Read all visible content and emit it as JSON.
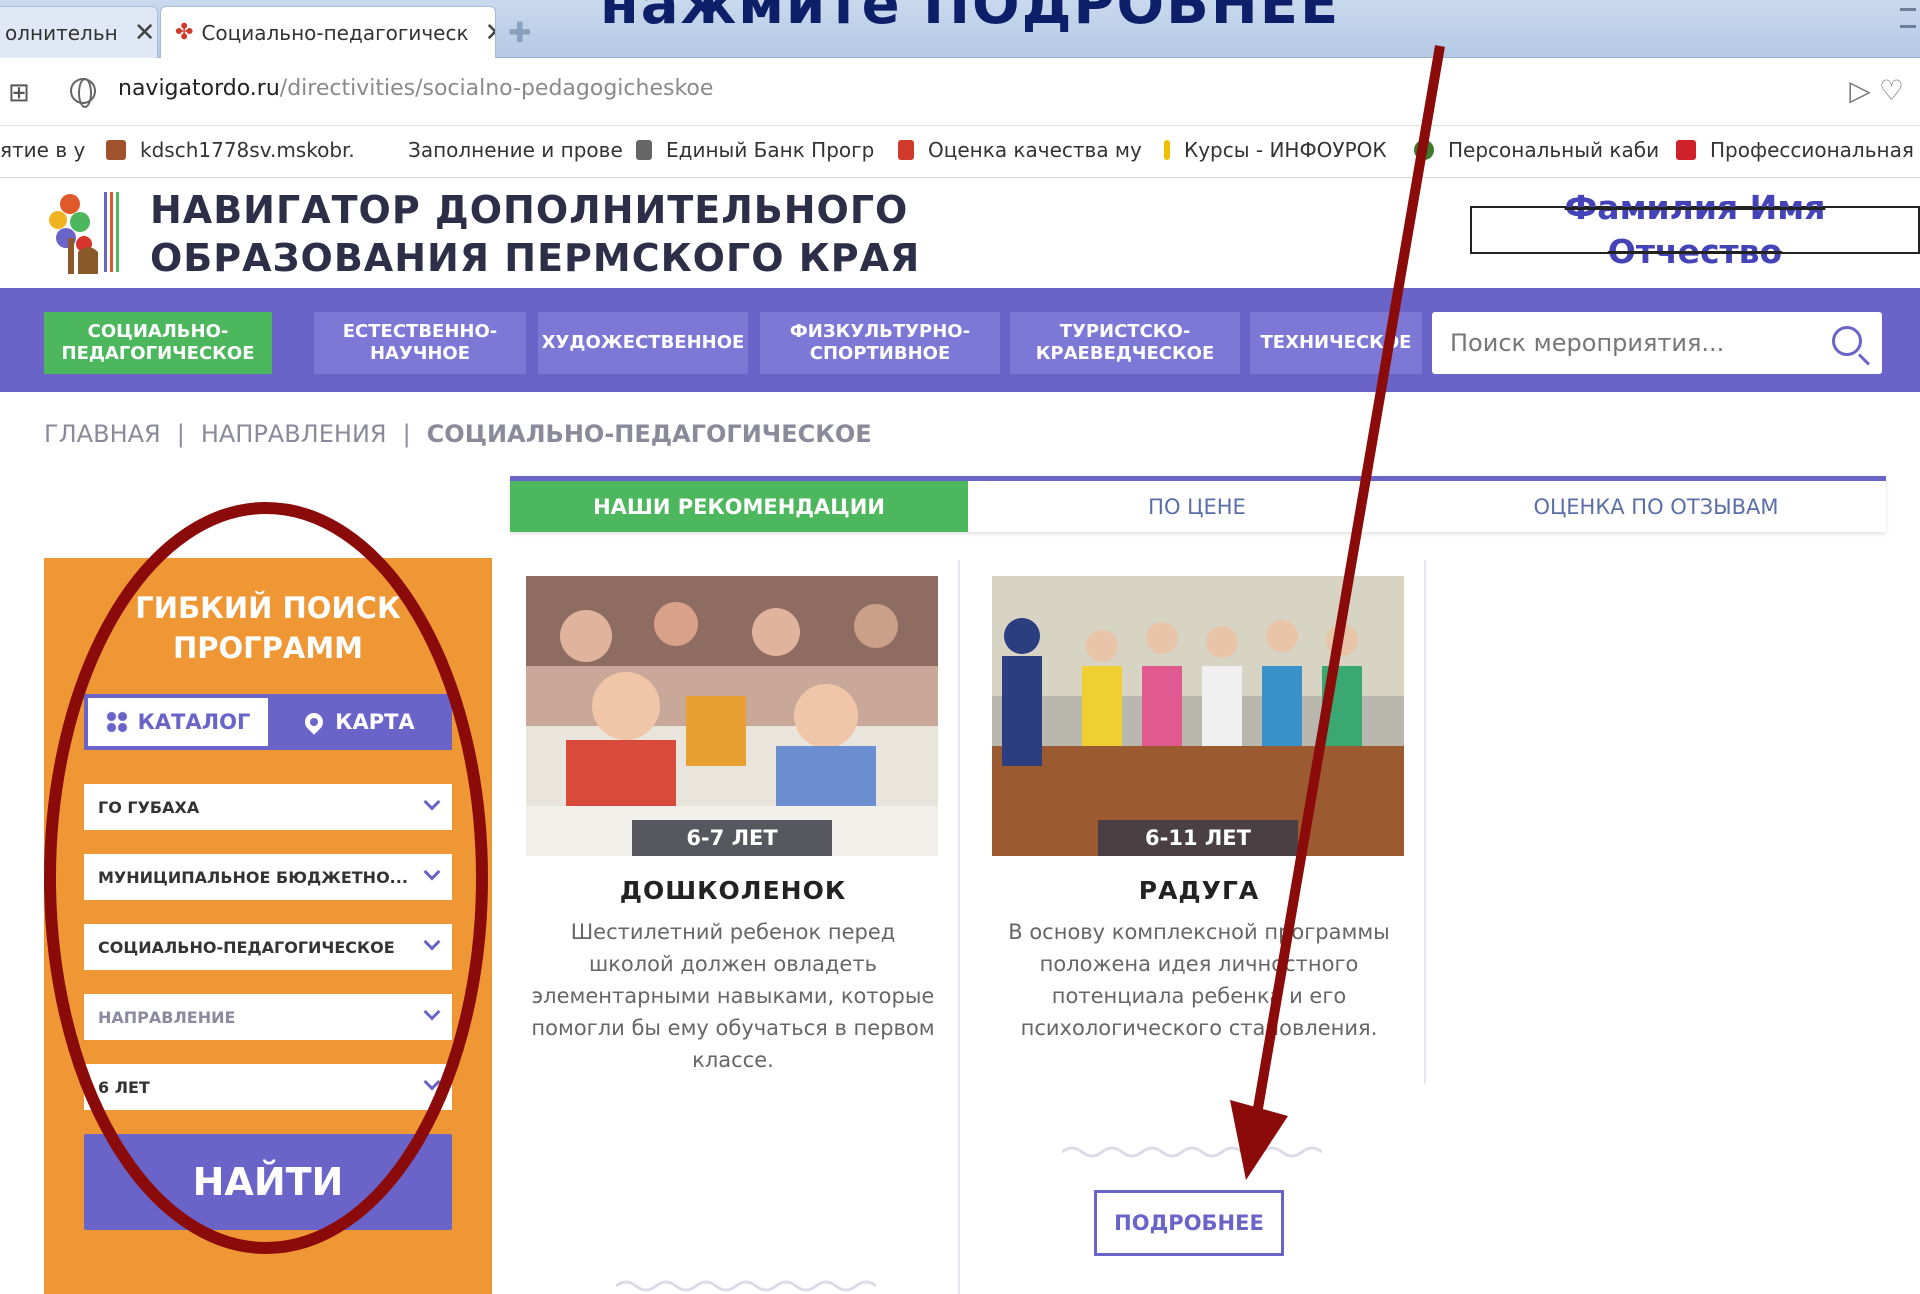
{
  "browser": {
    "tabs": [
      {
        "label": "олнительн",
        "active": false
      },
      {
        "label": "Социально-педагогическ",
        "active": true
      }
    ],
    "url_domain": "navigatordo.ru",
    "url_path": "/directivities/socialno-pedagogicheskoe",
    "bookmarks": [
      {
        "label": "ятие в у",
        "icon": "bookmark-icon"
      },
      {
        "label": "kdsch1778sv.mskobr.",
        "icon": "site-icon"
      },
      {
        "label": "Заполнение и прове",
        "icon": "bookmark-icon"
      },
      {
        "label": "Единый Банк Прогр",
        "icon": "file-icon"
      },
      {
        "label": "Оценка качества му",
        "icon": "shield-icon"
      },
      {
        "label": "Курсы - ИНФОУРОК",
        "icon": "bookmark-icon"
      },
      {
        "label": "Персональный каби",
        "icon": "leaf-icon"
      },
      {
        "label": "Профессиональная",
        "icon": "u-icon"
      }
    ]
  },
  "header": {
    "title_line1": "НАВИГАТОР ДОПОЛНИТЕЛЬНОГО",
    "title_line2": "ОБРАЗОВАНИЯ ПЕРМСКОГО КРАЯ",
    "login_line1": "Фамилия Имя",
    "login_line2": "Отчество"
  },
  "nav": {
    "items": [
      {
        "line1": "Социально-",
        "line2": "педагогическое",
        "active": true
      },
      {
        "line1": "Естественно-",
        "line2": "научное",
        "active": false
      },
      {
        "line1": "Художественное",
        "line2": "",
        "active": false
      },
      {
        "line1": "Физкультурно-",
        "line2": "спортивное",
        "active": false
      },
      {
        "line1": "Туристско-",
        "line2": "краеведческое",
        "active": false
      },
      {
        "line1": "Техническое",
        "line2": "",
        "active": false
      }
    ],
    "search_placeholder": "Поиск мероприятия..."
  },
  "breadcrumb": {
    "items": [
      "ГЛАВНАЯ",
      "НАПРАВЛЕНИЯ",
      "СОЦИАЛЬНО-ПЕДАГОГИЧЕСКОЕ"
    ],
    "separator": "|"
  },
  "sort_tabs": [
    {
      "label": "НАШИ РЕКОМЕНДАЦИИ",
      "active": true
    },
    {
      "label": "ПО ЦЕНЕ",
      "active": false
    },
    {
      "label": "ОЦЕНКА ПО ОТЗЫВАМ",
      "active": false
    }
  ],
  "filter": {
    "title_line1": "ГИБКИЙ ПОИСК",
    "title_line2": "ПРОГРАММ",
    "view_catalog": "КАТАЛОГ",
    "view_map": "КАРТА",
    "selects": [
      {
        "value": "ГО ГУБАХА",
        "placeholder": false
      },
      {
        "value": "МУНИЦИПАЛЬНОЕ БЮДЖЕТНО...",
        "placeholder": false
      },
      {
        "value": "СОЦИАЛЬНО-ПЕДАГОГИЧЕСКОЕ",
        "placeholder": false
      },
      {
        "value": "НАПРАВЛЕНИЕ",
        "placeholder": true
      },
      {
        "value": "6 ЛЕТ",
        "placeholder": false
      }
    ],
    "find_label": "НАЙТИ"
  },
  "cards": [
    {
      "age": "6-7 ЛЕТ",
      "title": "ДОШКОЛЕНОК",
      "description": "Шестилетний ребенок перед школой должен овладеть элементарными навыками, которые помогли бы ему обучаться в первом классе."
    },
    {
      "age": "6-11 ЛЕТ",
      "title": "РАДУГА",
      "description": "В основу комплексной программы положена идея личностного потенциала ребенка и его психологического становления."
    }
  ],
  "more_label": "ПОДРОБНЕЕ",
  "annotation": {
    "title": "нажмите ПОДРОБНЕЕ"
  },
  "colors": {
    "nav_purple": "#6b64c8",
    "active_green": "#4cb75d",
    "filter_orange": "#ef9735",
    "annotation_red": "#8b0a0a"
  }
}
